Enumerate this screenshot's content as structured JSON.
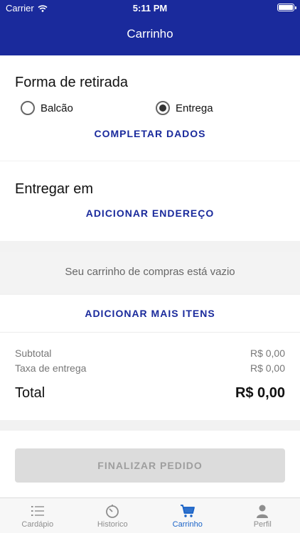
{
  "status": {
    "carrier": "Carrier",
    "time": "5:11 PM"
  },
  "header": {
    "title": "Carrinho"
  },
  "pickup": {
    "title": "Forma de retirada",
    "options": [
      "Balcão",
      "Entrega"
    ],
    "selected": "Entrega",
    "complete_label": "COMPLETAR DADOS"
  },
  "delivery": {
    "title": "Entregar em",
    "add_address_label": "ADICIONAR ENDEREÇO"
  },
  "cart": {
    "empty_text": "Seu carrinho de compras está vazio",
    "add_items_label": "ADICIONAR MAIS ITENS"
  },
  "summary": {
    "subtotal_label": "Subtotal",
    "subtotal_value": "R$ 0,00",
    "fee_label": "Taxa de entrega",
    "fee_value": "R$ 0,00",
    "total_label": "Total",
    "total_value": "R$ 0,00"
  },
  "checkout": {
    "label": "FINALIZAR PEDIDO"
  },
  "tabs": [
    {
      "label": "Cardápio",
      "icon": "list-icon"
    },
    {
      "label": "Historico",
      "icon": "timer-icon"
    },
    {
      "label": "Carrinho",
      "icon": "cart-icon",
      "active": true
    },
    {
      "label": "Perfil",
      "icon": "person-icon"
    }
  ],
  "colors": {
    "primary": "#1a2a9c",
    "tab_active": "#1a63c7",
    "button_disabled": "#dcdcdc"
  }
}
